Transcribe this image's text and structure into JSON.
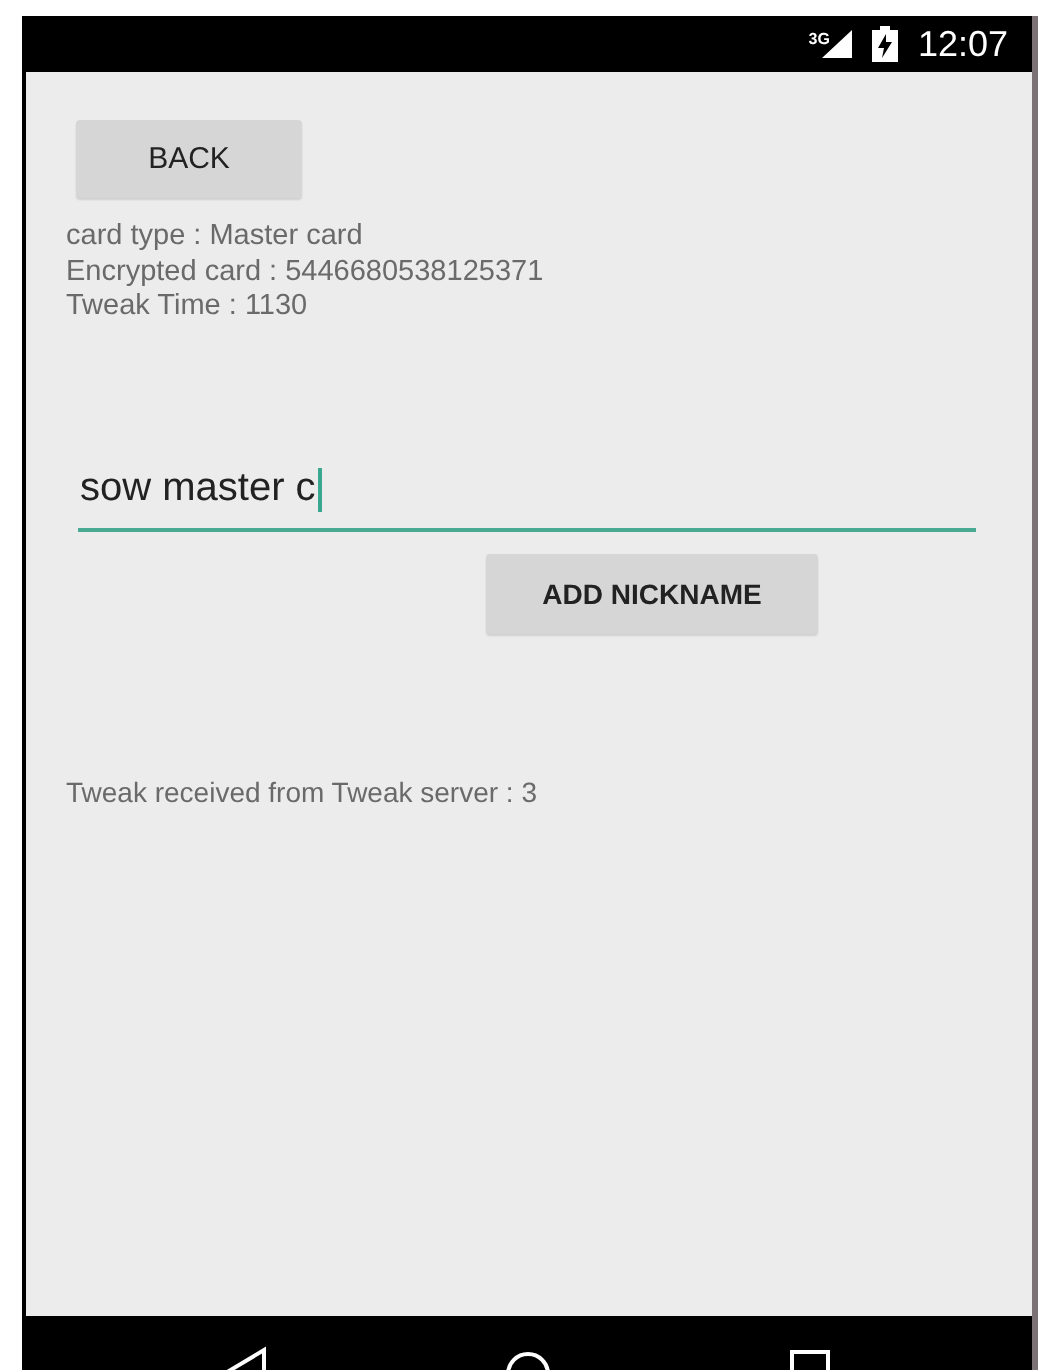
{
  "status_bar": {
    "network": "3G",
    "time": "12:07"
  },
  "back_button": {
    "label": "BACK"
  },
  "card_info": [
    "card type : Master card",
    "Encrypted card : 5446680538125371",
    "Tweak Time : 1130"
  ],
  "nickname_field": {
    "value": "sow master c",
    "focused": true
  },
  "add_button": {
    "label": "ADD NICKNAME"
  },
  "tweak_message": "Tweak received from Tweak server : 3"
}
